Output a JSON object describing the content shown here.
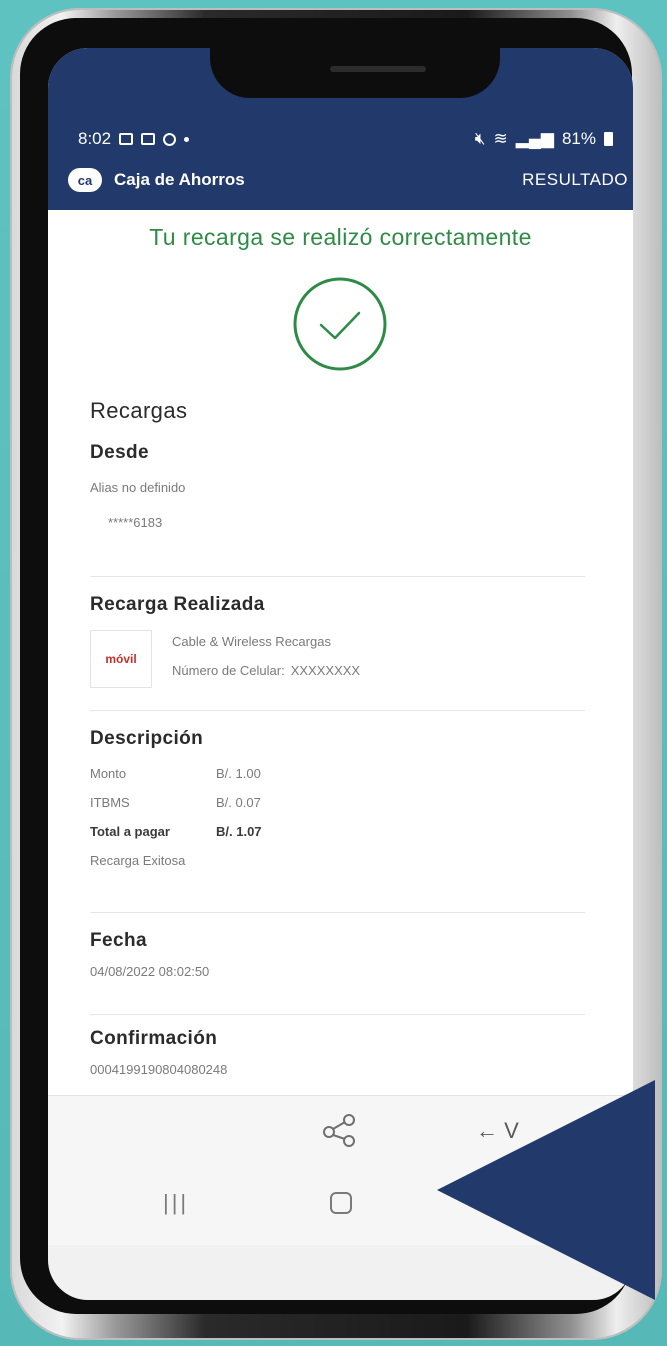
{
  "status_bar": {
    "time": "8:02",
    "signal_text": "81%"
  },
  "appbar": {
    "logo_text": "ca",
    "brand": "Caja de Ahorros",
    "title": "RESULTADO"
  },
  "result": {
    "message": "Tu recarga se realizó correctamente"
  },
  "recargas": {
    "heading": "Recargas",
    "desde": {
      "label": "Desde",
      "alias": "Alias no definido",
      "account": "*****6183"
    },
    "recarga_realizada": {
      "label": "Recarga Realizada",
      "logo_text": "móvil",
      "provider": "Cable & Wireless Recargas",
      "phone_label": "Número de Celular:",
      "phone_value": "XXXXXXXX"
    },
    "descripcion": {
      "label": "Descripción",
      "rows": [
        {
          "key": "Monto",
          "value": "B/.  1.00"
        },
        {
          "key": "ITBMS",
          "value": "B/.  0.07"
        },
        {
          "key": "Total a pagar",
          "value": "B/.  1.07"
        }
      ],
      "status": "Recarga Exitosa"
    },
    "fecha": {
      "label": "Fecha",
      "value": "04/08/2022 08:02:50"
    },
    "confirmacion": {
      "label": "Confirmación",
      "value": "000419919080408024​8"
    }
  },
  "actions": {
    "back_label": "← V"
  },
  "colors": {
    "header_blue": "#213a6b",
    "success_green": "#2e8b46",
    "background_teal": "#5ec3c0",
    "overlay_navy": "#213a6b"
  },
  "icons": [
    "share-icon",
    "back-arrow-icon",
    "recents-icon",
    "home-icon",
    "check-icon"
  ]
}
